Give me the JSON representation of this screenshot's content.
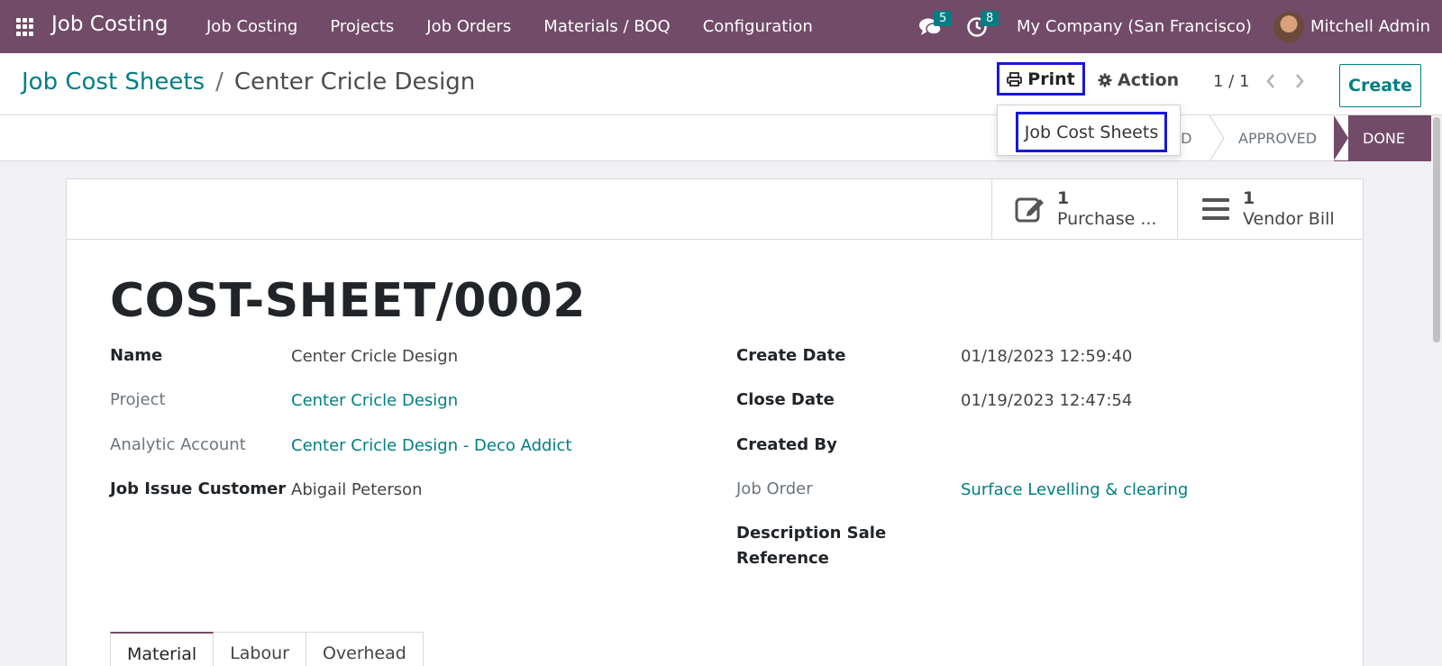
{
  "navbar": {
    "app_title": "Job Costing",
    "menu": [
      "Job Costing",
      "Projects",
      "Job Orders",
      "Materials / BOQ",
      "Configuration"
    ],
    "messages_badge": "5",
    "activities_badge": "8",
    "company": "My Company (San Francisco)",
    "user": "Mitchell Admin"
  },
  "breadcrumb": {
    "parent": "Job Cost Sheets",
    "separator": "/",
    "current": "Center Cricle Design"
  },
  "toolbar": {
    "print_label": "Print",
    "action_label": "Action",
    "pager": "1 / 1",
    "create_label": "Create"
  },
  "print_dropdown": {
    "items": [
      "Job Cost Sheets"
    ]
  },
  "statusbar": {
    "stages": [
      "ED",
      "APPROVED",
      "DONE"
    ],
    "active": "DONE"
  },
  "smart_buttons": [
    {
      "count": "1",
      "label": "Purchase ...",
      "icon": "edit-icon"
    },
    {
      "count": "1",
      "label": "Vendor Bill",
      "icon": "list-icon"
    }
  ],
  "record": {
    "title": "COST-SHEET/0002",
    "left_fields": [
      {
        "label": "Name",
        "value": "Center Cricle Design"
      },
      {
        "label": "Project",
        "value": "Center Cricle Design"
      },
      {
        "label": "Analytic Account",
        "value": "Center Cricle Design - Deco Addict"
      },
      {
        "label": "Job Issue Customer",
        "value": "Abigail Peterson"
      }
    ],
    "right_fields": [
      {
        "label": "Create Date",
        "value": "01/18/2023 12:59:40"
      },
      {
        "label": "Close Date",
        "value": "01/19/2023 12:47:54"
      },
      {
        "label": "Created By",
        "value": ""
      },
      {
        "label": "Job Order",
        "value": "Surface Levelling & clearing"
      },
      {
        "label_line1": "Description Sale",
        "label_line2": "Reference",
        "value": ""
      }
    ]
  },
  "tabs": [
    "Material",
    "Labour",
    "Overhead"
  ],
  "colors": {
    "brand": "#714b67",
    "link": "#017e84",
    "highlight_box": "#1818d8"
  }
}
